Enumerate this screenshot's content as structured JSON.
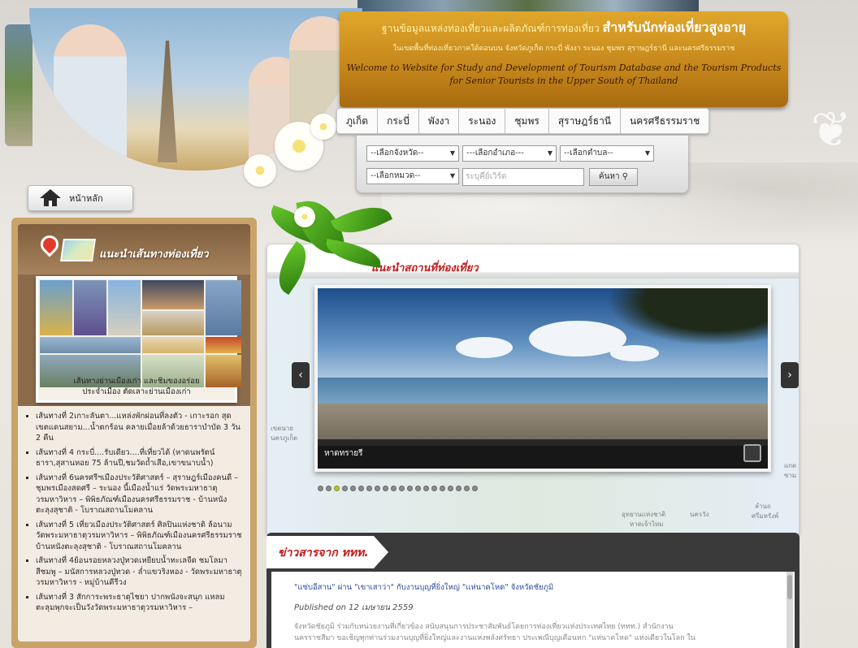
{
  "banner": {
    "title_prefix": "ฐานข้อมูลแหล่งท่องเที่ยวและผลิตภัณฑ์การท่องเที่ยว",
    "title_main": "สำหรับนักท่องเที่ยวสูงอายุ",
    "subtitle": "ในเขตพื้นที่ท่องเที่ยวภาคใต้ตอนบน จังหวัดภูเก็ต กระบี่ พังงา ระนอง ชุมพร สุราษฎร์ธานี และนครศรีธรรมราช",
    "english_line1": "Welcome to Website for Study and Development of Tourism Database and the Tourism Products",
    "english_line2": "for Senior Tourists in the Upper South of Thailand"
  },
  "nav": {
    "items": [
      "ภูเก็ต",
      "กระบี่",
      "พังงา",
      "ระนอง",
      "ชุมพร",
      "สุราษฎร์ธานี",
      "นครศรีธรรมราช"
    ]
  },
  "filters": {
    "province": "--เลือกจังหวัด--",
    "district": "---เลือกอำเภอ---",
    "subdistrict": "--เลือกตำบล--",
    "category": "--เลือกหมวด--",
    "search_placeholder": "ระบุคีย์เวิร์ด",
    "search_button": "ค้นหา"
  },
  "home": {
    "label": "หน้าหลัก"
  },
  "sidebar": {
    "title": "แนะนำเส้นทางท่องเที่ยว",
    "photo_caption_line1": "เส้นทางย่านเมืองเก่า และชิมของอร่อย",
    "photo_caption_line2": "ประจำเมือง ตัดเลาะย่านเมืองเก่า",
    "routes": [
      "เส้นทางที่ 2เกาะลันตา...แหล่งพักผ่อนที่ลงตัว - เกาะรอก สุดเขตแดนสยาม...น้ำตกร้อน คลายเมื่อยล้าด้วยธาราบำบัด 3 วัน 2 คืน",
      "เส้นทางที่ 4 กระบี่....รับเดียว....ที่เที่ยวได้ (หาดนพรัตน์ธารา,สุสานหอย 75 ล้านปี,ชมวัดถ้ำเสือ,เขาขนาบน้ำ)",
      "เส้นทางที่ 6นครศรีฯเมืองประวัติศาสตร์ – สุราษฎร์เมืองคนดี – ชุมพรเมืองสดศรี – ระนอง นี้เมืองน้ำแร่ วัดพระมหาธาตุวรมหาวิหาร – พิพิธภัณฑ์เมืองนครศรีธรรมราช - บ้านหนังตะลุงสุชาติ - โบราณสถานโมคลาน",
      "เส้นทางที่ 5 เที่ยวเมืองประวัติศาสตร์ ศิลปินแห่งชาติ ล้อนาม วัดพระมหาธาตุวรมหาวิหาร – พิพิธภัณฑ์เมืองนครศรีธรรมราช บ้านหนังตะลุงสุชาติ - โบราณสถานโมคลาน",
      "เส้นทางที่ 4ย้อนรอยหลวงปู่ทวดเหยียบน้ำทะเลจืด ชมโลมาสีชมพู – มนัสการหลวงปู่ทวด - ล่ำแขวริงหอง - วัดพระมหาธาตุวรมหาวิหาร - หมู่บ้านคีรีวง",
      "เส้นทางที่ 3 สักการะพระธาตุไชยา ปากพนังจะสนุก แหลมตะลุมพุกจะเป็นวังวัดพระมหาธาตุวรมหาวิหาร –"
    ]
  },
  "main": {
    "section_title": "แนะนำสถานที่ท่องเที่ยว",
    "slide_caption": "หาดทรายรี",
    "prev_label": "‹",
    "next_label": "›",
    "dot_count": 20,
    "active_dot": 2,
    "map_labels": [
      "เขตนาย",
      "นครภูเก็ต",
      "อุทยานแห่งชาติ",
      "หาดเจ้าไหม",
      "นครวัง",
      "ลำนถ",
      "ศรีมหรังค์",
      "แกด",
      "ซาม"
    ]
  },
  "news": {
    "tab_label": "ข่าวสารจาก ททท.",
    "headline": "\"แซ่บอีสาน\" ผ่าน \"เขาเสาว่า\" กับงานบุญที่ยิ่งใหญ่ \"แห่นาคโหด\" จังหวัดชัยภูมิ",
    "date": "Published on 12 เมษายน 2559",
    "text_line1": "จังหวัดชัยภูมิ ร่วมกับหน่วยงานที่เกี่ยวข้อง สนับสนุนการประชาสัมพันธ์โดยการท่องเที่ยวแห่งประเทศไทย (ททท.) สำนักงาน",
    "text_line2": "นครราชสีมา ขอเชิญทุกท่านร่วมงานบุญที่ยิ่งใหญ่และงานแห่งพลังศรัทธา ประเพณีบุญเดือนหก \"แห่นาคโหด\" แห่งเดียวในโลก ใน"
  },
  "colors": {
    "banner_gold": "#c4851a",
    "title_red": "#c41a1a",
    "headline_blue": "#2b4d9c",
    "sidebar_brown": "#8b6b4a"
  }
}
